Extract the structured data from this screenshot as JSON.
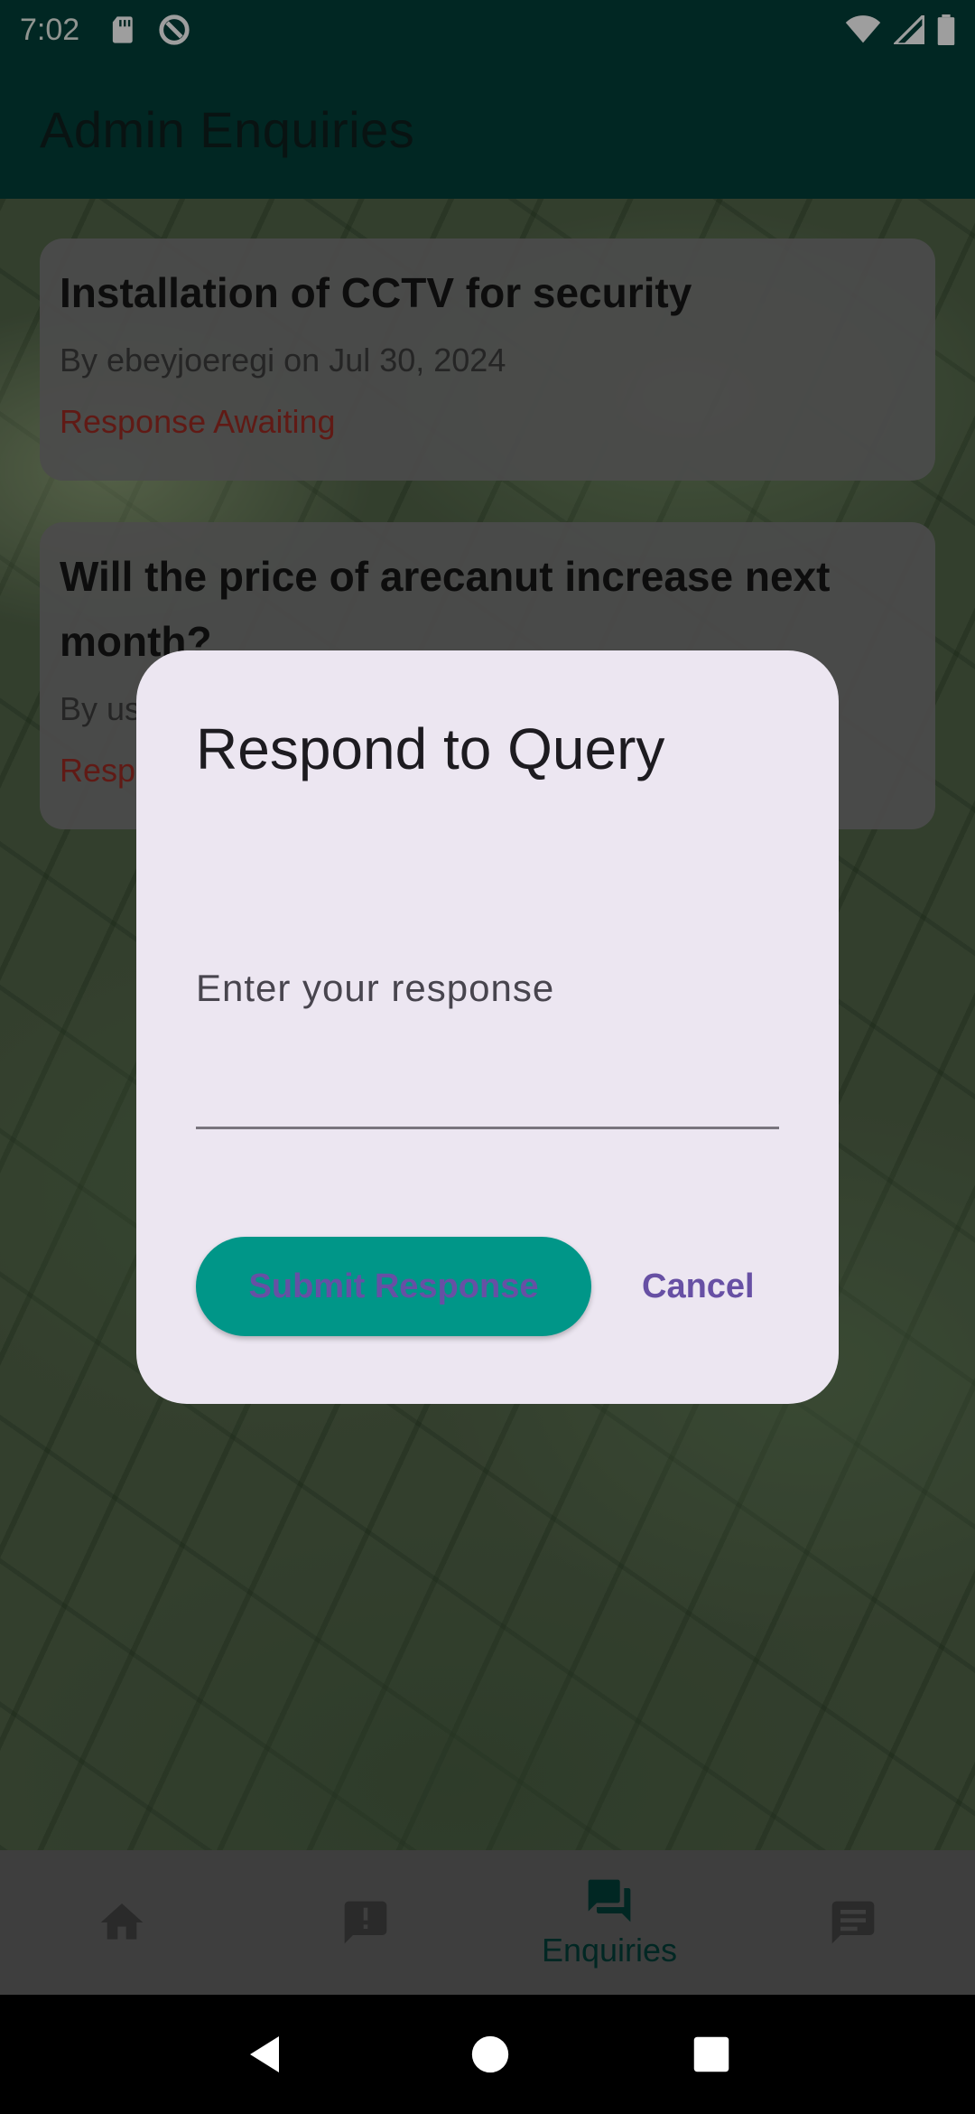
{
  "status_bar": {
    "time": "7:02",
    "icons": [
      "sd-card-icon",
      "data-saver-icon",
      "wifi-icon",
      "signal-icon",
      "battery-icon"
    ]
  },
  "app_bar": {
    "title": "Admin Enquiries"
  },
  "enquiries": [
    {
      "title": "Installation of CCTV for security",
      "meta": "By ebeyjoeregi on Jul 30, 2024",
      "status": "Response Awaiting"
    },
    {
      "title": "Will the price of arecanut increase next month?",
      "meta": "By us",
      "status": "Resp"
    }
  ],
  "dialog": {
    "title": "Respond to Query",
    "field_label": "Enter your response",
    "field_value": "",
    "submit_label": "Submit Response",
    "cancel_label": "Cancel"
  },
  "bottom_nav": {
    "items": [
      {
        "icon": "home-icon",
        "label": ""
      },
      {
        "icon": "report-icon",
        "label": ""
      },
      {
        "icon": "forum-icon",
        "label": "Enquiries",
        "active": true
      },
      {
        "icon": "feedback-icon",
        "label": ""
      }
    ]
  },
  "colors": {
    "app_bar": "#023f39",
    "accent_teal": "#009688",
    "dialog_bg": "#ece6f1",
    "primary_purple": "#6750a4",
    "status_red": "#9c2b22",
    "nav_active": "#023f39",
    "nav_inactive": "#444444"
  }
}
